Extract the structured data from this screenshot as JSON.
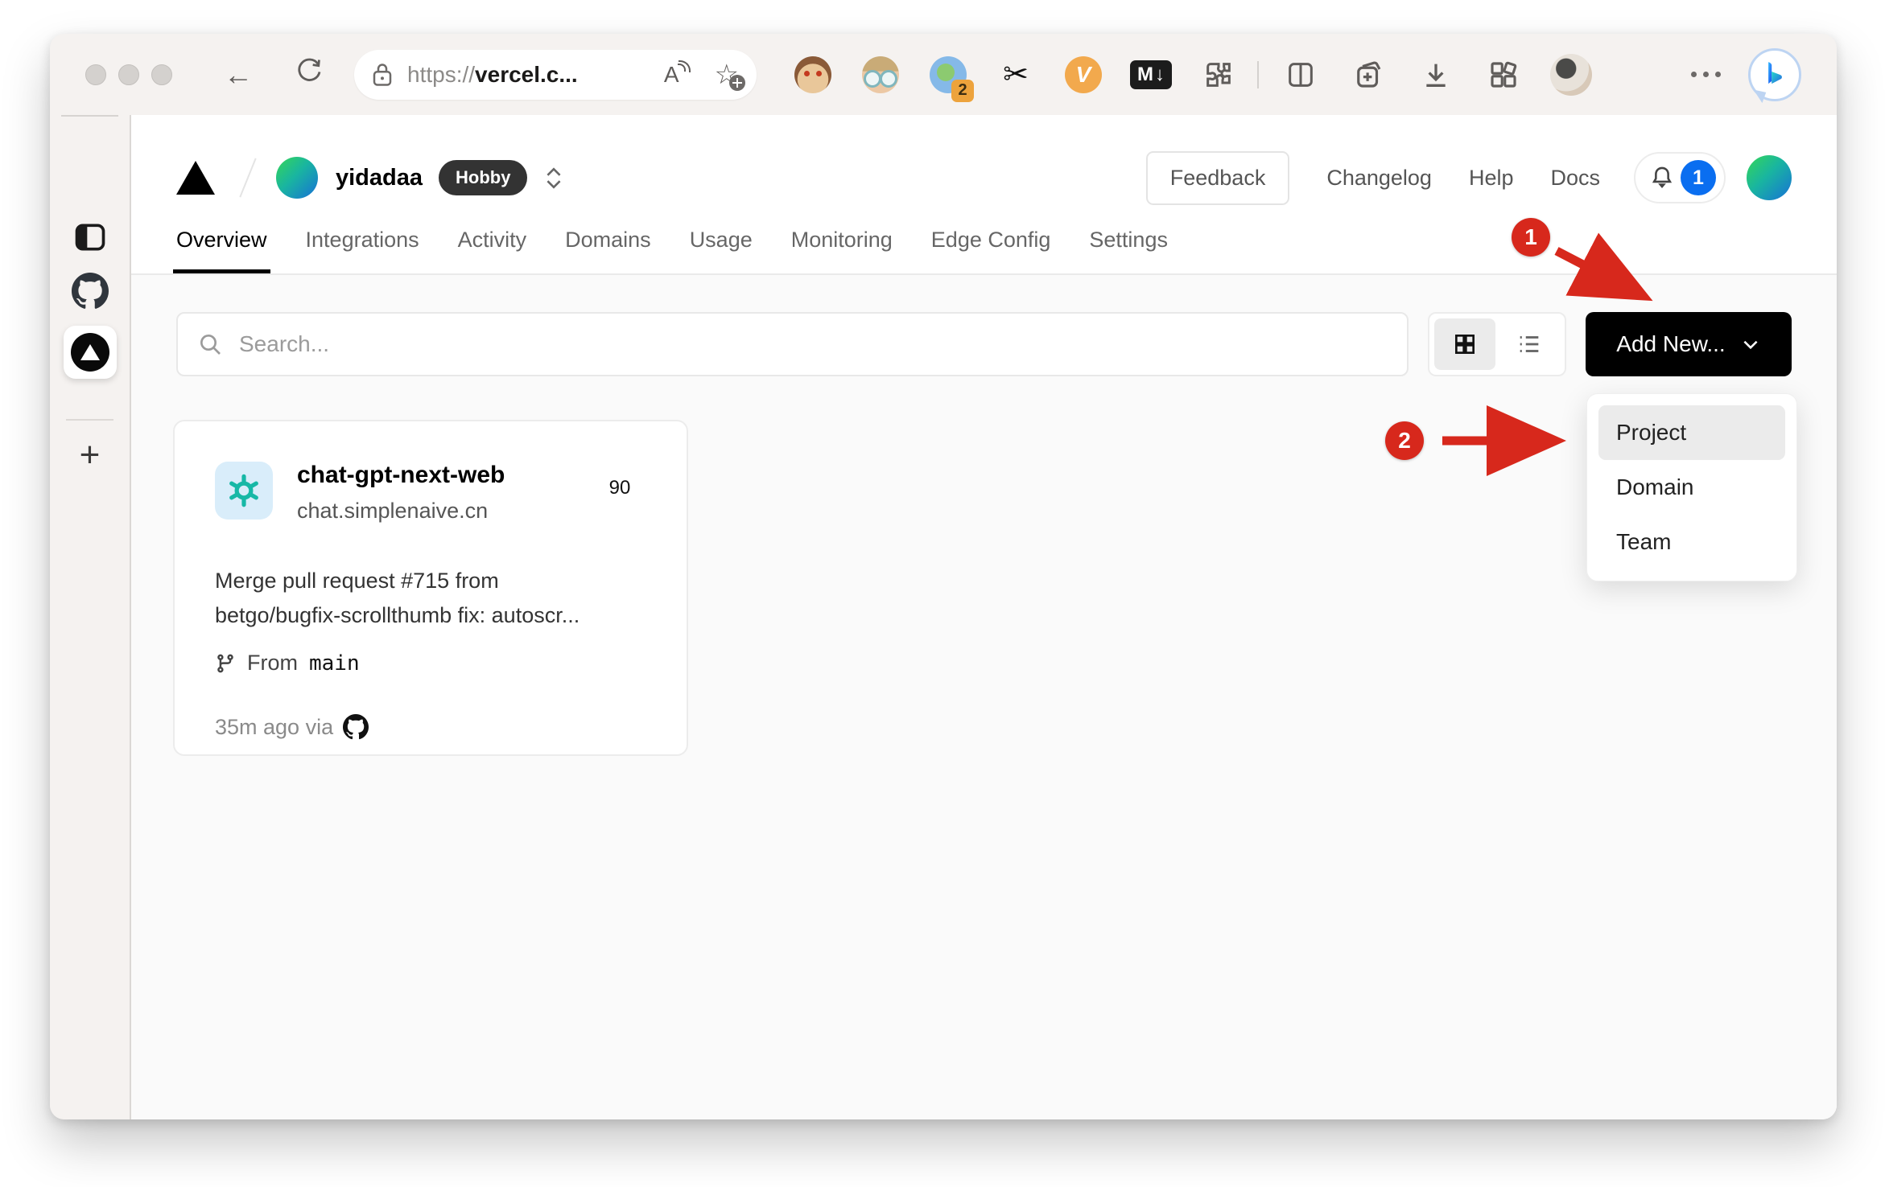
{
  "browser": {
    "url": {
      "prefix": "https://",
      "host": "vercel.c..."
    },
    "icons": {
      "back": "←",
      "scissors": "✂",
      "star": "☆",
      "reading": "A",
      "md_label": "M",
      "md_arrow": "↓",
      "v_label": "V"
    },
    "ext_badge": "2"
  },
  "edge_sidebar": {
    "plus": "+"
  },
  "header": {
    "team_name": "yidadaa",
    "plan": "Hobby",
    "feedback": "Feedback",
    "changelog": "Changelog",
    "help": "Help",
    "docs": "Docs",
    "notification_count": "1"
  },
  "tabs": [
    {
      "label": "Overview",
      "active": true
    },
    {
      "label": "Integrations",
      "active": false
    },
    {
      "label": "Activity",
      "active": false
    },
    {
      "label": "Domains",
      "active": false
    },
    {
      "label": "Usage",
      "active": false
    },
    {
      "label": "Monitoring",
      "active": false
    },
    {
      "label": "Edge Config",
      "active": false
    },
    {
      "label": "Settings",
      "active": false
    }
  ],
  "content": {
    "search_placeholder": "Search...",
    "add_new_label": "Add New..."
  },
  "dropdown": {
    "items": [
      {
        "label": "Project",
        "highlighted": true
      },
      {
        "label": "Domain",
        "highlighted": false
      },
      {
        "label": "Team",
        "highlighted": false
      }
    ]
  },
  "card": {
    "name": "chat-gpt-next-web",
    "domain": "chat.simplenaive.cn",
    "score": "90",
    "commit_line1": "Merge pull request #715 from",
    "commit_line2": "betgo/bugfix-scrollthumb fix: autoscr...",
    "from_label": "From",
    "branch": "main",
    "meta_prefix": "35m ago via"
  },
  "annotations": {
    "step1": "1",
    "step2": "2"
  },
  "colors": {
    "annotation_red": "#d7281c",
    "ring_green": "#2fbe5f",
    "notification_blue": "#0a6ef0",
    "add_new_bg": "#000000",
    "plan_badge_bg": "#333333"
  }
}
